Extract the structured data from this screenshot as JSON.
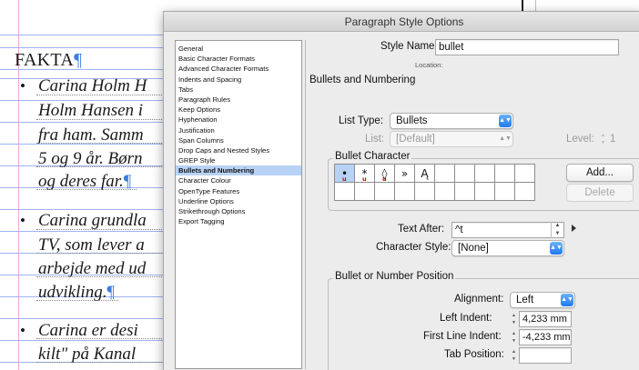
{
  "document": {
    "heading": "FAKTA",
    "pilcrow": "¶",
    "bullet_glyph": "•",
    "lines": [
      "Carina Holm H",
      "Holm Hansen i",
      "fra ham. Samm",
      "5 og 9 år. Børn",
      "og deres far.",
      "Carina grundla",
      "TV, som lever a",
      "arbejde med ud",
      "udvikling.",
      "Carina er desi",
      "kilt\" på Kanal"
    ]
  },
  "dialog": {
    "title": "Paragraph Style Options",
    "sidebar": {
      "items": [
        "General",
        "Basic Character Formats",
        "Advanced Character Formats",
        "Indents and Spacing",
        "Tabs",
        "Paragraph Rules",
        "Keep Options",
        "Hyphenation",
        "Justification",
        "Span Columns",
        "Drop Caps and Nested Styles",
        "GREP Style",
        "Bullets and Numbering",
        "Character Colour",
        "OpenType Features",
        "Underline Options",
        "Strikethrough Options",
        "Export Tagging"
      ],
      "selected_index": 12
    },
    "style_name_label": "Style Name:",
    "style_name_value": "bullet",
    "location_label": "Location:",
    "section_title": "Bullets and Numbering",
    "list_type_label": "List Type:",
    "list_type_value": "Bullets",
    "list_label": "List:",
    "list_value": "[Default]",
    "level_label": "Level:",
    "level_value": "1",
    "bullet_character": {
      "title": "Bullet Character",
      "glyphs": [
        "•",
        "*",
        "◊",
        "»",
        "Ą"
      ],
      "underline_marks": [
        "u",
        "u",
        "u",
        "",
        ""
      ],
      "add_label": "Add...",
      "delete_label": "Delete"
    },
    "text_after_label": "Text After:",
    "text_after_value": "^t",
    "character_style_label": "Character Style:",
    "character_style_value": "[None]",
    "position": {
      "title": "Bullet or Number Position",
      "alignment_label": "Alignment:",
      "alignment_value": "Left",
      "left_indent_label": "Left Indent:",
      "left_indent_value": "4,233 mm",
      "first_line_indent_label": "First Line Indent:",
      "first_line_indent_value": "-4,233 mm",
      "tab_position_label": "Tab Position:",
      "tab_position_value": ""
    }
  },
  "colors": {
    "selection": "#b7d2f5",
    "accent": "#1e79f0",
    "pilcrow": "#3a7de0",
    "guide_blue": "#9fb3f2",
    "guide_pink": "#e8a7d6"
  }
}
